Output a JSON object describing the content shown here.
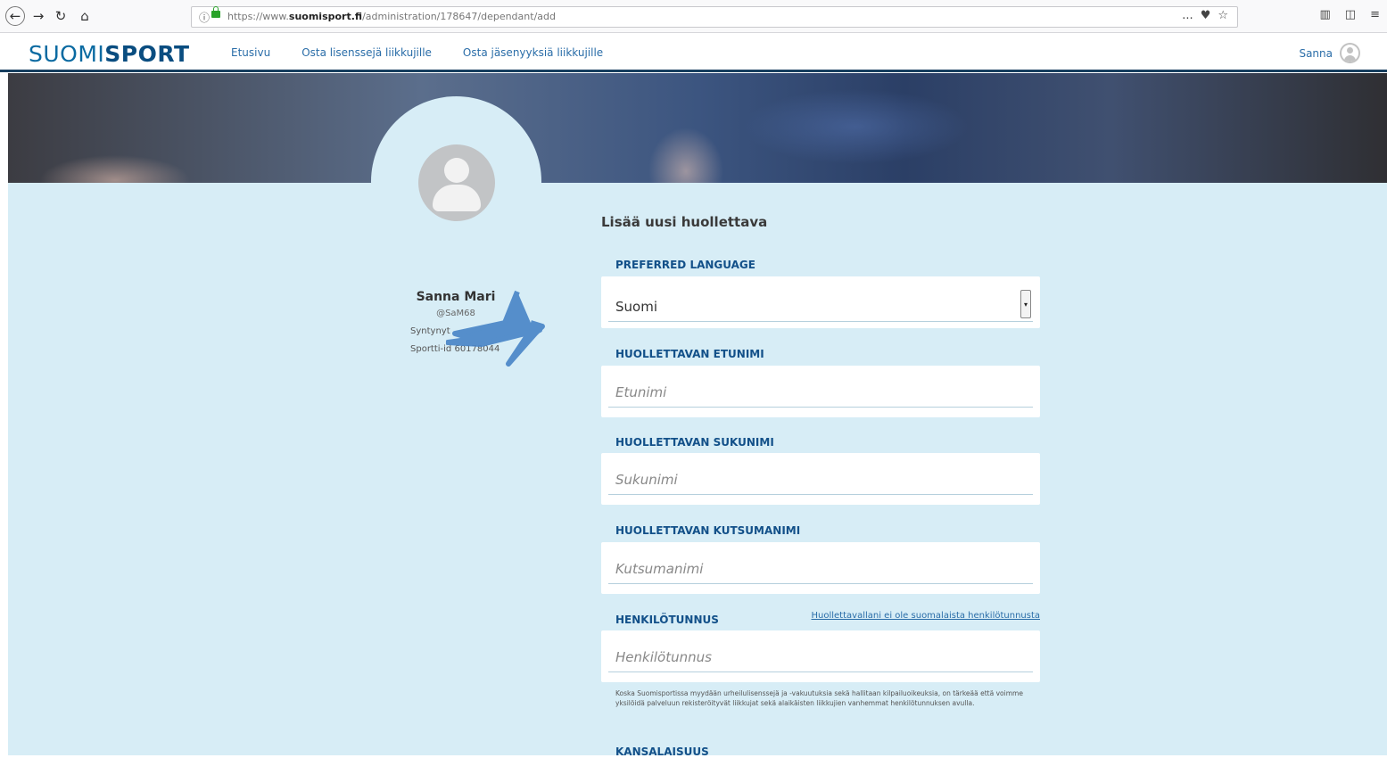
{
  "browser": {
    "url_prefix": "https://www.",
    "url_domain": "suomisport.fi",
    "url_path": "/administration/178647/dependant/add",
    "info_icon": "info-icon",
    "menu_icon": "..."
  },
  "header": {
    "logo_light": "SUOMI",
    "logo_bold": "SPORT",
    "nav": [
      {
        "label": "Etusivu"
      },
      {
        "label": "Osta lisenssejä liikkujille"
      },
      {
        "label": "Osta jäsenyyksiä liikkujille"
      }
    ],
    "user_name": "Sanna"
  },
  "profile": {
    "name": "Sanna Mari",
    "handle": "@SaM68",
    "born": "Syntynyt",
    "sportti_id": "Sportti-id 60178044"
  },
  "form": {
    "title": "Lisää uusi huollettava",
    "language": {
      "label": "PREFERRED LANGUAGE",
      "value": "Suomi"
    },
    "first_name": {
      "label": "HUOLLETTAVAN ETUNIMI",
      "placeholder": "Etunimi"
    },
    "last_name": {
      "label": "HUOLLETTAVAN SUKUNIMI",
      "placeholder": "Sukunimi"
    },
    "nickname": {
      "label": "HUOLLETTAVAN KUTSUMANIMI",
      "placeholder": "Kutsumanimi"
    },
    "ssn": {
      "label": "HENKILÖTUNNUS",
      "placeholder": "Henkilötunnus",
      "no_finnish_link": "Huollettavallani ei ole suomalaista henkilötunnusta",
      "helper": "Koska Suomisportissa myydään urheilulisenssejä ja -vakuutuksia sekä hallitaan kilpailuoikeuksia, on tärkeää että voimme yksilöidä palveluun rekisteröityvät liikkujat sekä alaikäisten liikkujien vanhemmat henkilötunnuksen avulla."
    },
    "citizenship": {
      "label": "KANSALAISUUS"
    }
  },
  "colors": {
    "header_border": "#173f5f",
    "content_bg": "#d7edf6",
    "label": "#125089",
    "link": "#2a6da8"
  }
}
